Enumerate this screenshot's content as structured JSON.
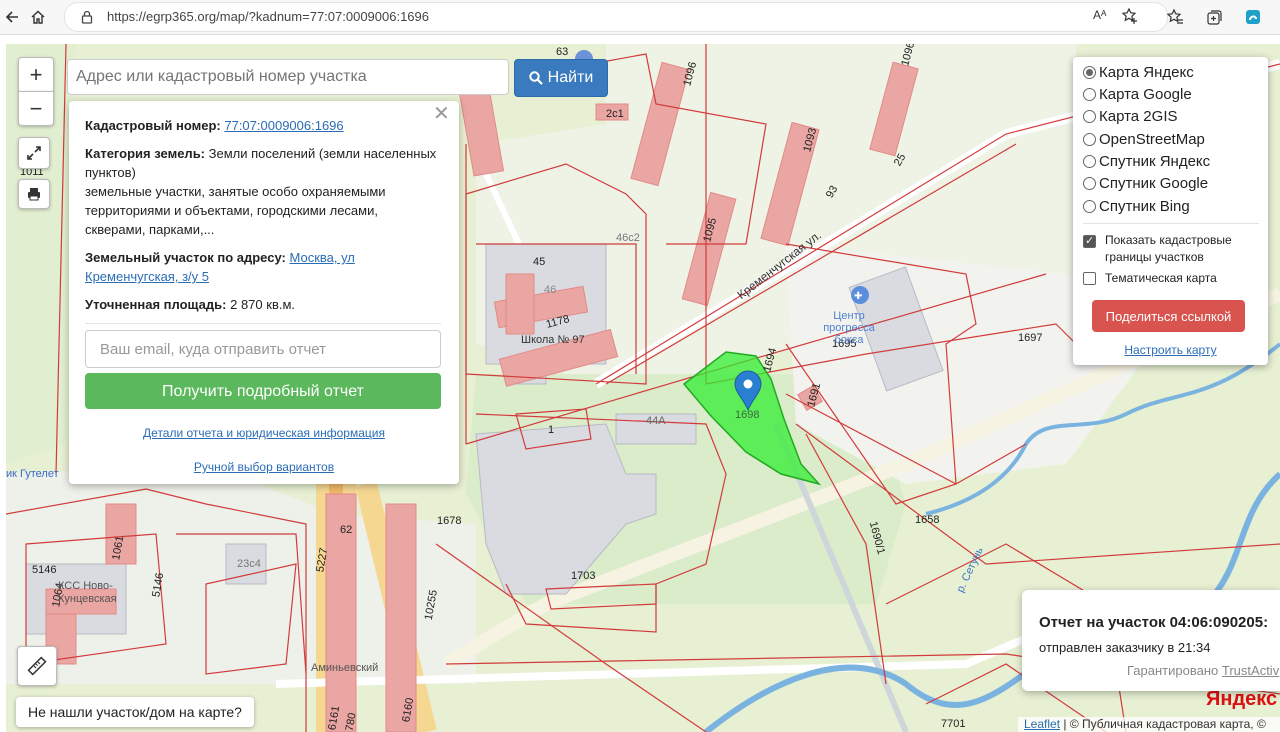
{
  "browser": {
    "url": "https://egrp365.org/map/?kadnum=77:07:0009006:1696",
    "icons": [
      "back-icon",
      "home-icon",
      "lock-icon",
      "read-aloud-icon",
      "favorite-icon",
      "favorites-icon",
      "collections-icon",
      "edge-icon"
    ]
  },
  "map_controls": {
    "zoom_in": "+",
    "zoom_out": "−",
    "search_placeholder": "Адрес или кадастровый номер участка",
    "search_button": "Найти",
    "not_found_button": "Не нашли участок/дом на карте?"
  },
  "popup": {
    "cadastral_label": "Кадастровый номер:",
    "cadastral_value": "77:07:0009006:1696",
    "category_label": "Категория земель:",
    "category_value": "Земли поселений (земли населенных пунктов)",
    "category_desc": "земельные участки, занятые особо охраняемыми территориями и объектами, городскими лесами, скверами, парками,...",
    "address_label": "Земельный участок по адресу:",
    "address_value": "Москва, ул Кременчугская, з/у 5",
    "area_label": "Уточненная площадь:",
    "area_value": "2 870 кв.м.",
    "email_placeholder": "Ваш email, куда отправить отчет",
    "get_report": "Получить подробный отчет",
    "details_link": "Детали отчета и юридическая информация",
    "manual_link": "Ручной выбор вариантов"
  },
  "layers": {
    "base_maps": [
      {
        "label": "Карта Яндекс",
        "selected": true
      },
      {
        "label": "Карта Google",
        "selected": false
      },
      {
        "label": "Карта 2GIS",
        "selected": false
      },
      {
        "label": "OpenStreetMap",
        "selected": false
      },
      {
        "label": "Спутник Яндекс",
        "selected": false
      },
      {
        "label": "Спутник Google",
        "selected": false
      },
      {
        "label": "Спутник Bing",
        "selected": false
      }
    ],
    "show_cadastral": "Показать кадастровые границы участков",
    "show_cadastral_checked": true,
    "thematic": "Тематическая карта",
    "thematic_checked": false,
    "share": "Поделиться ссылкой",
    "configure": "Настроить карту"
  },
  "toast": {
    "title": "Отчет на участок 04:06:090205:",
    "subtitle": "отправлен заказчику в 21:34",
    "guarantee": "Гарантировано",
    "guarantee_link": "TrustActiv"
  },
  "map_labels": {
    "street": "Кременчугская ул.",
    "poi": "Центр прогресса бокса",
    "school": "Школа № 97",
    "gutelet": "ик Гутелет",
    "kss": "КСС Ново-Кунцевская",
    "amin": "Аминьевский",
    "river": "р. Сетунь",
    "yandex": "Яндекс",
    "parcels": [
      "63",
      "1096",
      "1096",
      "1093",
      "1095",
      "45",
      "46",
      "1178",
      "46с2",
      "1695",
      "1694",
      "1698",
      "1691",
      "1697",
      "44А",
      "1",
      "1678",
      "62",
      "5227",
      "1703",
      "1061",
      "1064",
      "5146",
      "5146",
      "23с4",
      "10255",
      "1658",
      "1690/1",
      "7701",
      "6161",
      "6160",
      "780",
      "93",
      "25",
      "1011",
      "2с1"
    ]
  },
  "attribution": {
    "leaflet": "Leaflet",
    "text": "| © Публичная кадастровая карта, ©"
  },
  "colors": {
    "primary_blue": "#3a7bbf",
    "success_green": "#5cb85c",
    "danger_red": "#d9534f",
    "parcel_line": "#d23b3b",
    "selected_parcel": "#33dd33"
  }
}
